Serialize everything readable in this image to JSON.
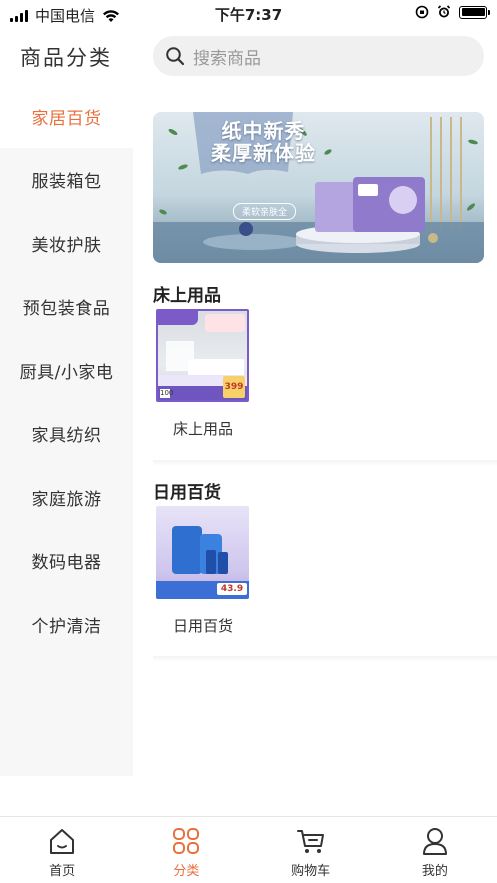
{
  "status_bar": {
    "carrier": "中国电信",
    "time": "下午7:37",
    "battery_level": 1.0
  },
  "header": {
    "title": "商品分类",
    "search_placeholder": "搜索商品"
  },
  "sidebar": {
    "active_index": 0,
    "items": [
      {
        "label": "家居百货"
      },
      {
        "label": "服装箱包"
      },
      {
        "label": "美妆护肤"
      },
      {
        "label": "预包装食品"
      },
      {
        "label": "厨具/小家电"
      },
      {
        "label": "家具纺织"
      },
      {
        "label": "家庭旅游"
      },
      {
        "label": "数码电器"
      },
      {
        "label": "个护清洁"
      }
    ]
  },
  "banner": {
    "title_line1": "纸中新秀",
    "title_line2": "柔厚新体验",
    "subtitle": "柔软亲肤全",
    "button": "柔软亲肤全"
  },
  "sections": [
    {
      "title": "床上用品",
      "products": [
        {
          "label": "床上用品",
          "price_tag": "399",
          "promo": "100"
        }
      ]
    },
    {
      "title": "日用百货",
      "products": [
        {
          "label": "日用百货",
          "price_tag": "43.9"
        }
      ]
    }
  ],
  "bottom_nav": {
    "active_index": 1,
    "items": [
      {
        "label": "首页",
        "icon": "home-icon"
      },
      {
        "label": "分类",
        "icon": "category-icon"
      },
      {
        "label": "购物车",
        "icon": "cart-icon"
      },
      {
        "label": "我的",
        "icon": "user-icon"
      }
    ]
  },
  "colors": {
    "accent": "#e8703d",
    "sidebar_bg": "#f7f7f7",
    "search_bg": "#f0f0f0"
  }
}
